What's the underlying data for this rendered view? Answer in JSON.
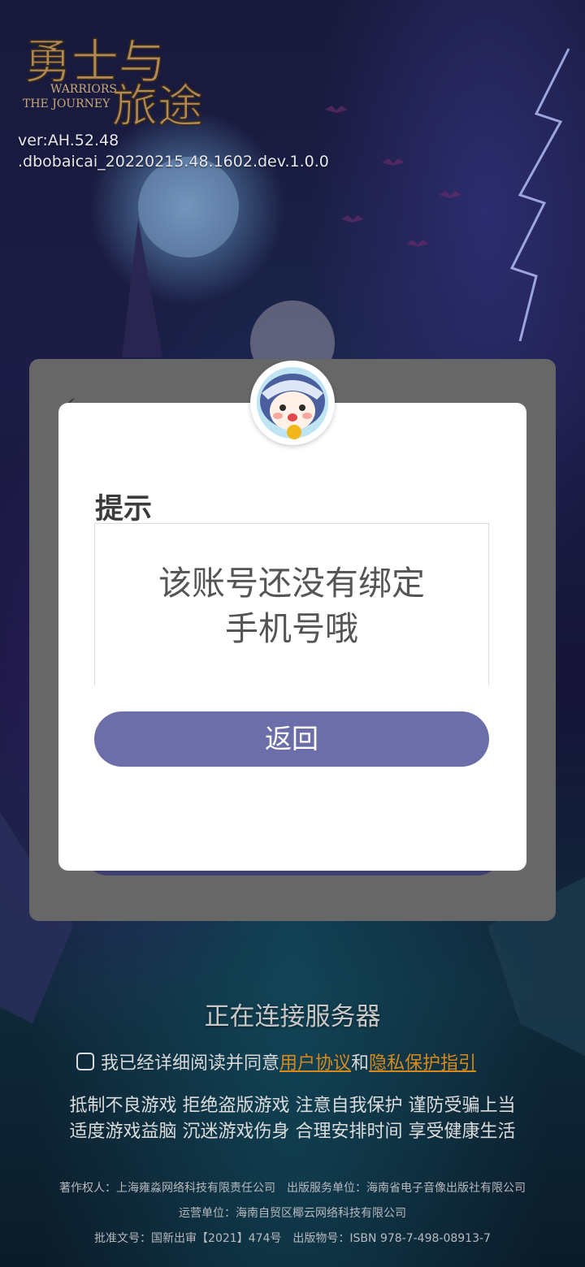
{
  "logo": {
    "title_cn": "勇士与旅途",
    "subtitle_en_1": "WARRIORS",
    "subtitle_en_2": "THE JOURNEY"
  },
  "version": {
    "line1": "ver:AH.52.48",
    "line2": ".dbobaicai_20220215.48.1602.dev.1.0.0"
  },
  "outer_panel": {
    "back_glyph": "‹"
  },
  "dialog": {
    "avatar_icon": "mascot-avatar-icon",
    "title": "提示",
    "message_line1": "该账号还没有绑定",
    "message_line2": "手机号哦",
    "button_label": "返回",
    "button_color": "#6b6ea9"
  },
  "status_text": "正在连接服务器",
  "agreement": {
    "prefix": "我已经详细阅读并同意",
    "user_agreement": "用户协议",
    "and": "和",
    "privacy_policy": "隐私保护指引",
    "link_color": "#d68a1c"
  },
  "health_notice": {
    "line1": "抵制不良游戏 拒绝盗版游戏 注意自我保护 谨防受骗上当",
    "line2": "适度游戏益脑 沉迷游戏伤身 合理安排时间 享受健康生活"
  },
  "copyright": {
    "line1": "著作权人：上海雍淼网络科技有限责任公司　出版服务单位：海南省电子音像出版社有限公司",
    "line2": "运营单位：海南自贸区椰云网络科技有限公司",
    "line3": "批准文号：国新出审【2021】474号　出版物号：ISBN 978-7-498-08913-7"
  }
}
